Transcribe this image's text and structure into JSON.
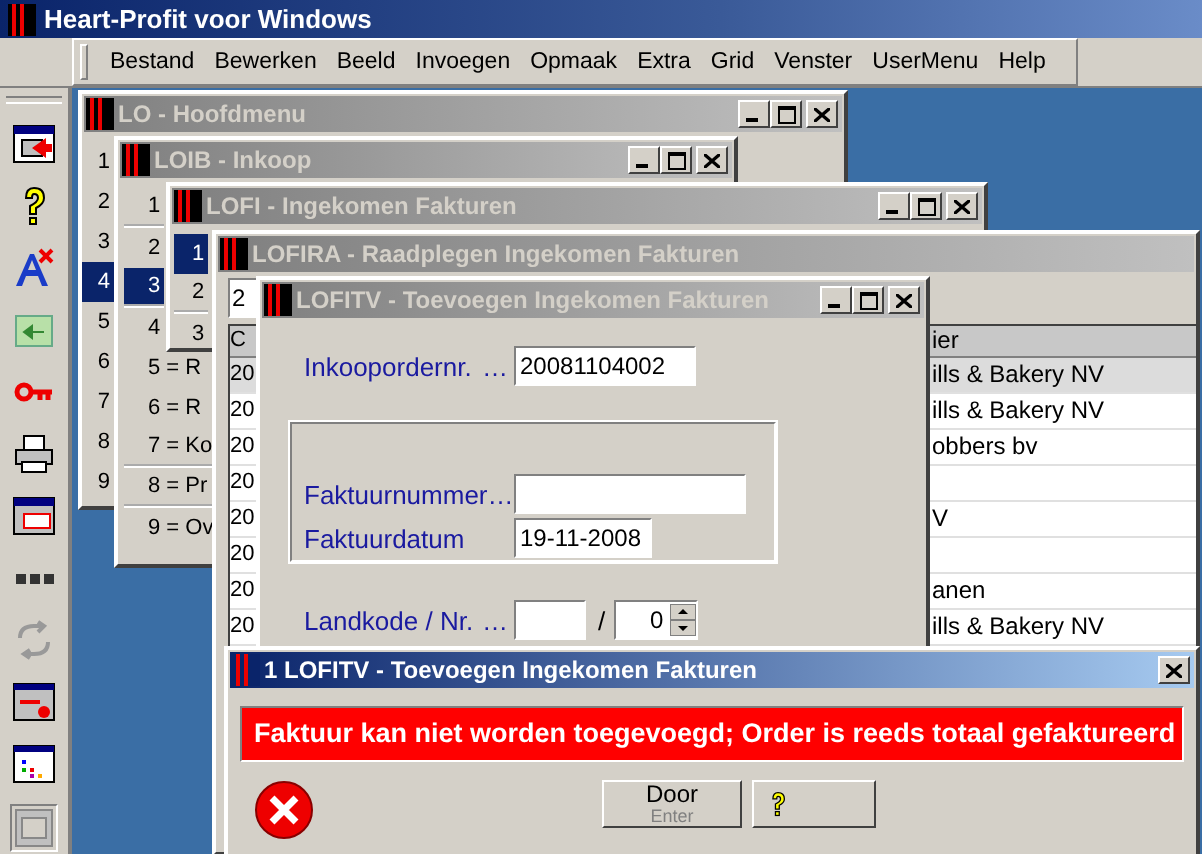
{
  "app": {
    "title": "Heart-Profit voor Windows"
  },
  "menu": [
    "Bestand",
    "Bewerken",
    "Beeld",
    "Invoegen",
    "Opmaak",
    "Extra",
    "Grid",
    "Venster",
    "UserMenu",
    "Help"
  ],
  "windows": [
    {
      "kind": "menu",
      "title": "LO - Hoofdmenu",
      "active": false,
      "controls": true,
      "items": [
        {
          "label": "1",
          "selected": false,
          "divider_below": false
        },
        {
          "label": "2",
          "selected": false,
          "divider_below": false
        },
        {
          "label": "3",
          "selected": false,
          "divider_below": false
        },
        {
          "label": "4",
          "selected": true,
          "divider_below": false
        },
        {
          "label": "5",
          "selected": false,
          "divider_below": false
        },
        {
          "label": "6",
          "selected": false,
          "divider_below": false
        },
        {
          "label": "7",
          "selected": false,
          "divider_below": false
        },
        {
          "label": "8",
          "selected": false,
          "divider_below": false
        },
        {
          "label": "9",
          "selected": false,
          "divider_below": false
        }
      ]
    },
    {
      "kind": "menu",
      "title": "LOIB - Inkoop",
      "active": false,
      "controls": true,
      "items": [
        {
          "label": "1",
          "selected": false,
          "divider_below": true
        },
        {
          "label": "2",
          "selected": false,
          "divider_below": false
        },
        {
          "label": "3",
          "selected": true,
          "divider_below": true
        },
        {
          "label": "4",
          "selected": false,
          "divider_below": false
        },
        {
          "label": "5 = R",
          "selected": false,
          "divider_below": false
        },
        {
          "label": "6 = R",
          "selected": false,
          "divider_below": false
        },
        {
          "label": "7 = Ko",
          "selected": false,
          "divider_below": true
        },
        {
          "label": "8 = Pr",
          "selected": false,
          "divider_below": true
        },
        {
          "label": "9 = Ov",
          "selected": false,
          "divider_below": false
        }
      ]
    },
    {
      "kind": "menu",
      "title": "LOFI - Ingekomen Fakturen",
      "active": false,
      "controls": true,
      "items": [
        {
          "label": "1",
          "selected": true,
          "divider_below": false
        },
        {
          "label": "2",
          "selected": false,
          "divider_below": true
        },
        {
          "label": "3",
          "selected": false,
          "divider_below": false
        }
      ]
    },
    {
      "kind": "lookup",
      "title": "LOFIRA - Raadplegen Ingekomen Fakturen",
      "active": false,
      "controls": false,
      "field": "2",
      "columns": [
        "C",
        "ier"
      ],
      "rows": [
        {
          "column_1": "20",
          "column_2": "ills & Bakery NV",
          "selected": true
        },
        {
          "column_1": "20",
          "column_2": "ills & Bakery NV",
          "selected": false
        },
        {
          "column_1": "20",
          "column_2": "obbers bv",
          "selected": false
        },
        {
          "column_1": "20",
          "selected": false
        },
        {
          "column_1": "20",
          "column_2": "V",
          "selected": false
        },
        {
          "column_1": "20",
          "selected": false
        },
        {
          "column_1": "20",
          "column_2": "anen",
          "selected": false
        },
        {
          "column_1": "20",
          "column_2": "ills & Bakery NV",
          "selected": false
        }
      ]
    },
    {
      "kind": "form",
      "title": "LOFITV - Toevoegen Ingekomen Fakturen",
      "active": false,
      "controls": true,
      "order": {
        "label": "Inkoopordernr.",
        "dots": "…",
        "value": "20081104002"
      },
      "group": [
        {
          "label": "Faktuurnummer…"
        },
        {
          "label": "Faktuurdatum",
          "value": "19-11-2008"
        }
      ],
      "country": {
        "label": "Landkode / Nr.",
        "dots": "…",
        "separator": "/",
        "number": "0"
      }
    }
  ],
  "dialog": {
    "title": "1 LOFITV - Toevoegen Ingekomen Fakturen",
    "active": true,
    "message": "Faktuur kan niet worden toegevoegd; Order is reeds totaal gefaktureerd",
    "buttons": [
      {
        "kind": "text",
        "label": "Door",
        "hint": "Enter"
      },
      {
        "kind": "help"
      }
    ]
  }
}
